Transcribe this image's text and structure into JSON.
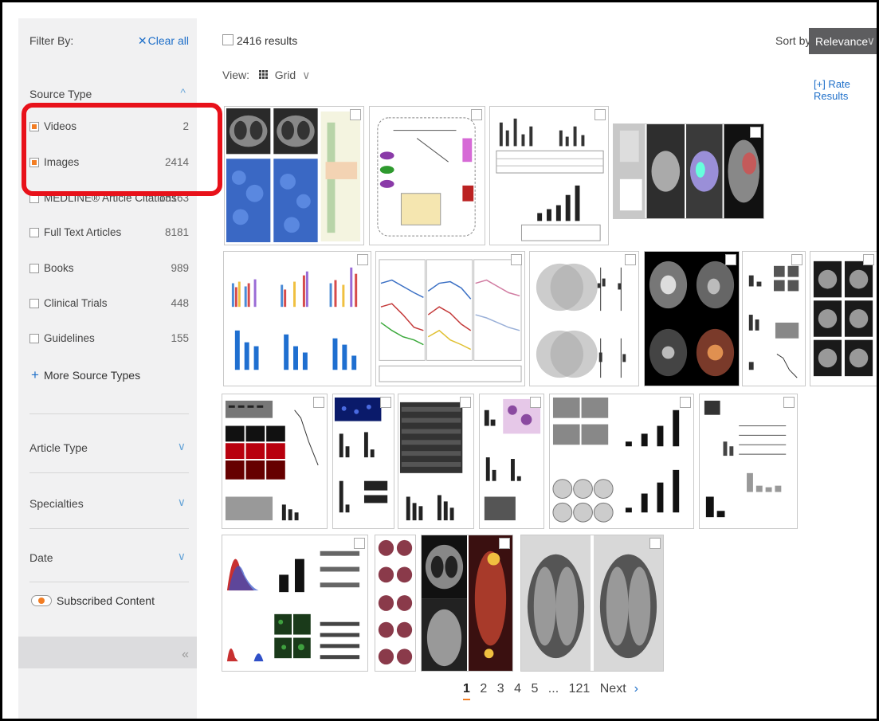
{
  "sidebar": {
    "filter_by": "Filter By:",
    "clear_all": "Clear all",
    "source_type": {
      "title": "Source Type",
      "items": [
        {
          "label": "Videos",
          "count": "2",
          "checked": true
        },
        {
          "label": "Images",
          "count": "2414",
          "checked": true
        },
        {
          "label": "MEDLINE® Article Citations",
          "count": "15163",
          "checked": false
        },
        {
          "label": "Full Text Articles",
          "count": "8181",
          "checked": false
        },
        {
          "label": "Books",
          "count": "989",
          "checked": false
        },
        {
          "label": "Clinical Trials",
          "count": "448",
          "checked": false
        },
        {
          "label": "Guidelines",
          "count": "155",
          "checked": false
        }
      ],
      "more": "More Source Types"
    },
    "article_type": "Article Type",
    "specialties": "Specialties",
    "date": "Date",
    "subscribed": "Subscribed Content"
  },
  "header": {
    "results": "2416 results",
    "sort_by": "Sort by:",
    "sort_value": "Relevance",
    "view_label": "View:",
    "view_value": "Grid",
    "rate_results": "[+] Rate Results"
  },
  "pagination": {
    "pages": [
      "1",
      "2",
      "3",
      "4",
      "5",
      "...",
      "121"
    ],
    "current": "1",
    "next": "Next"
  },
  "colors": {
    "accent_orange": "#f27d23",
    "link_blue": "#1e6fc9",
    "highlight_red": "#e8111a",
    "sidebar_bg": "#f1f1f2"
  }
}
